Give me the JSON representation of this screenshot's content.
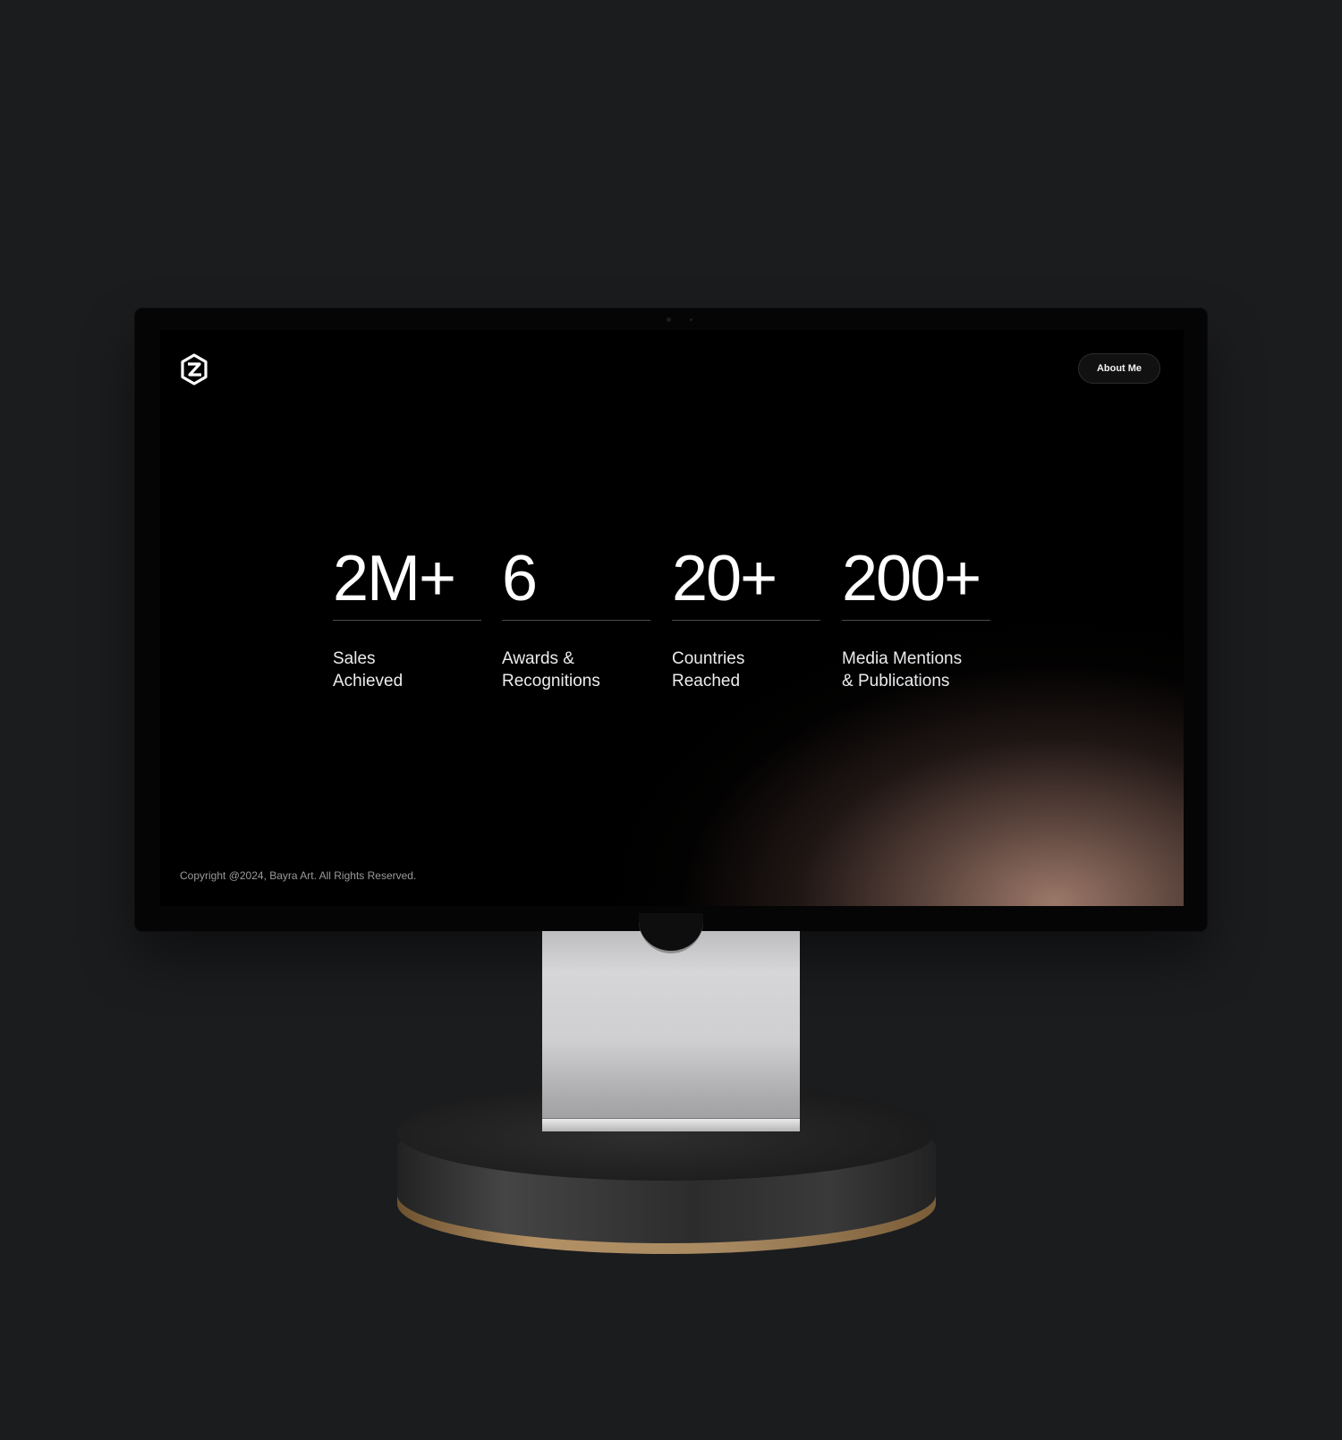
{
  "header": {
    "logo_icon": "hexagon-logo-icon",
    "about_button": "About Me"
  },
  "stats": [
    {
      "value": "2M+",
      "label": "Sales\nAchieved"
    },
    {
      "value": "6",
      "label": "Awards &\nRecognitions"
    },
    {
      "value": "20+",
      "label": "Countries\nReached"
    },
    {
      "value": "200+",
      "label": "Media Mentions\n& Publications"
    }
  ],
  "footer": {
    "copyright": "Copyright @2024, Bayra Art. All Rights Reserved."
  },
  "colors": {
    "background": "#1b1c1e",
    "screen": "#000000",
    "glow": "#a47e6e",
    "accent_rim": "#b39064"
  }
}
